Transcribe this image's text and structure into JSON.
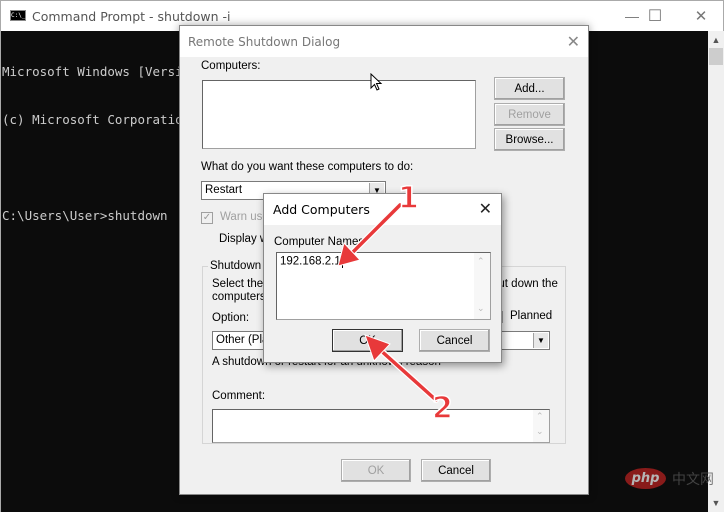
{
  "console": {
    "title": "Command Prompt - shutdown  -i",
    "icon_text": "C:\\_",
    "lines": [
      "Microsoft Windows [Version",
      "(c) Microsoft Corporation",
      "",
      "C:\\Users\\User>shutdown  -i"
    ],
    "controls": {
      "minimize": "—",
      "maximize": "☐",
      "close": "✕"
    }
  },
  "remote_shutdown": {
    "title": "Remote Shutdown Dialog",
    "computers_label": "Computers:",
    "computers_list": [],
    "add_button": "Add...",
    "remove_button": "Remove",
    "browse_button": "Browse...",
    "action_label": "What do you want these computers to do:",
    "action_value": "Restart",
    "warn_users_label": "Warn users of the action",
    "warn_users_checked": true,
    "display_warning_label": "Display warning for",
    "event_tracker_group": "Shutdown Event Tracker",
    "select_reason_text_1": "Select the option that best describes why you want to shut down the",
    "select_reason_text_2": "computers",
    "option_label": "Option:",
    "option_value": "Other (Planned)",
    "planned_label": "Planned",
    "reason_description": "A shutdown or restart for an unknown reason",
    "comment_label": "Comment:",
    "comment_value": "",
    "ok_button": "OK",
    "cancel_button": "Cancel"
  },
  "add_computers": {
    "title": "Add Computers",
    "name_label": "Computer Names",
    "name_value": "192.168.2.1",
    "ok_button": "OK",
    "cancel_button": "Cancel"
  },
  "annotations": [
    {
      "label": "1",
      "target": "computer-names-input"
    },
    {
      "label": "2",
      "target": "add-computers-ok-button"
    }
  ],
  "watermark": {
    "logo": "php",
    "text": "中文网"
  },
  "colors": {
    "console_bg": "#0c0c0c",
    "console_text": "#cccccc",
    "dialog_bg": "#f0f0f0",
    "annotation_red": "#e8393a"
  }
}
